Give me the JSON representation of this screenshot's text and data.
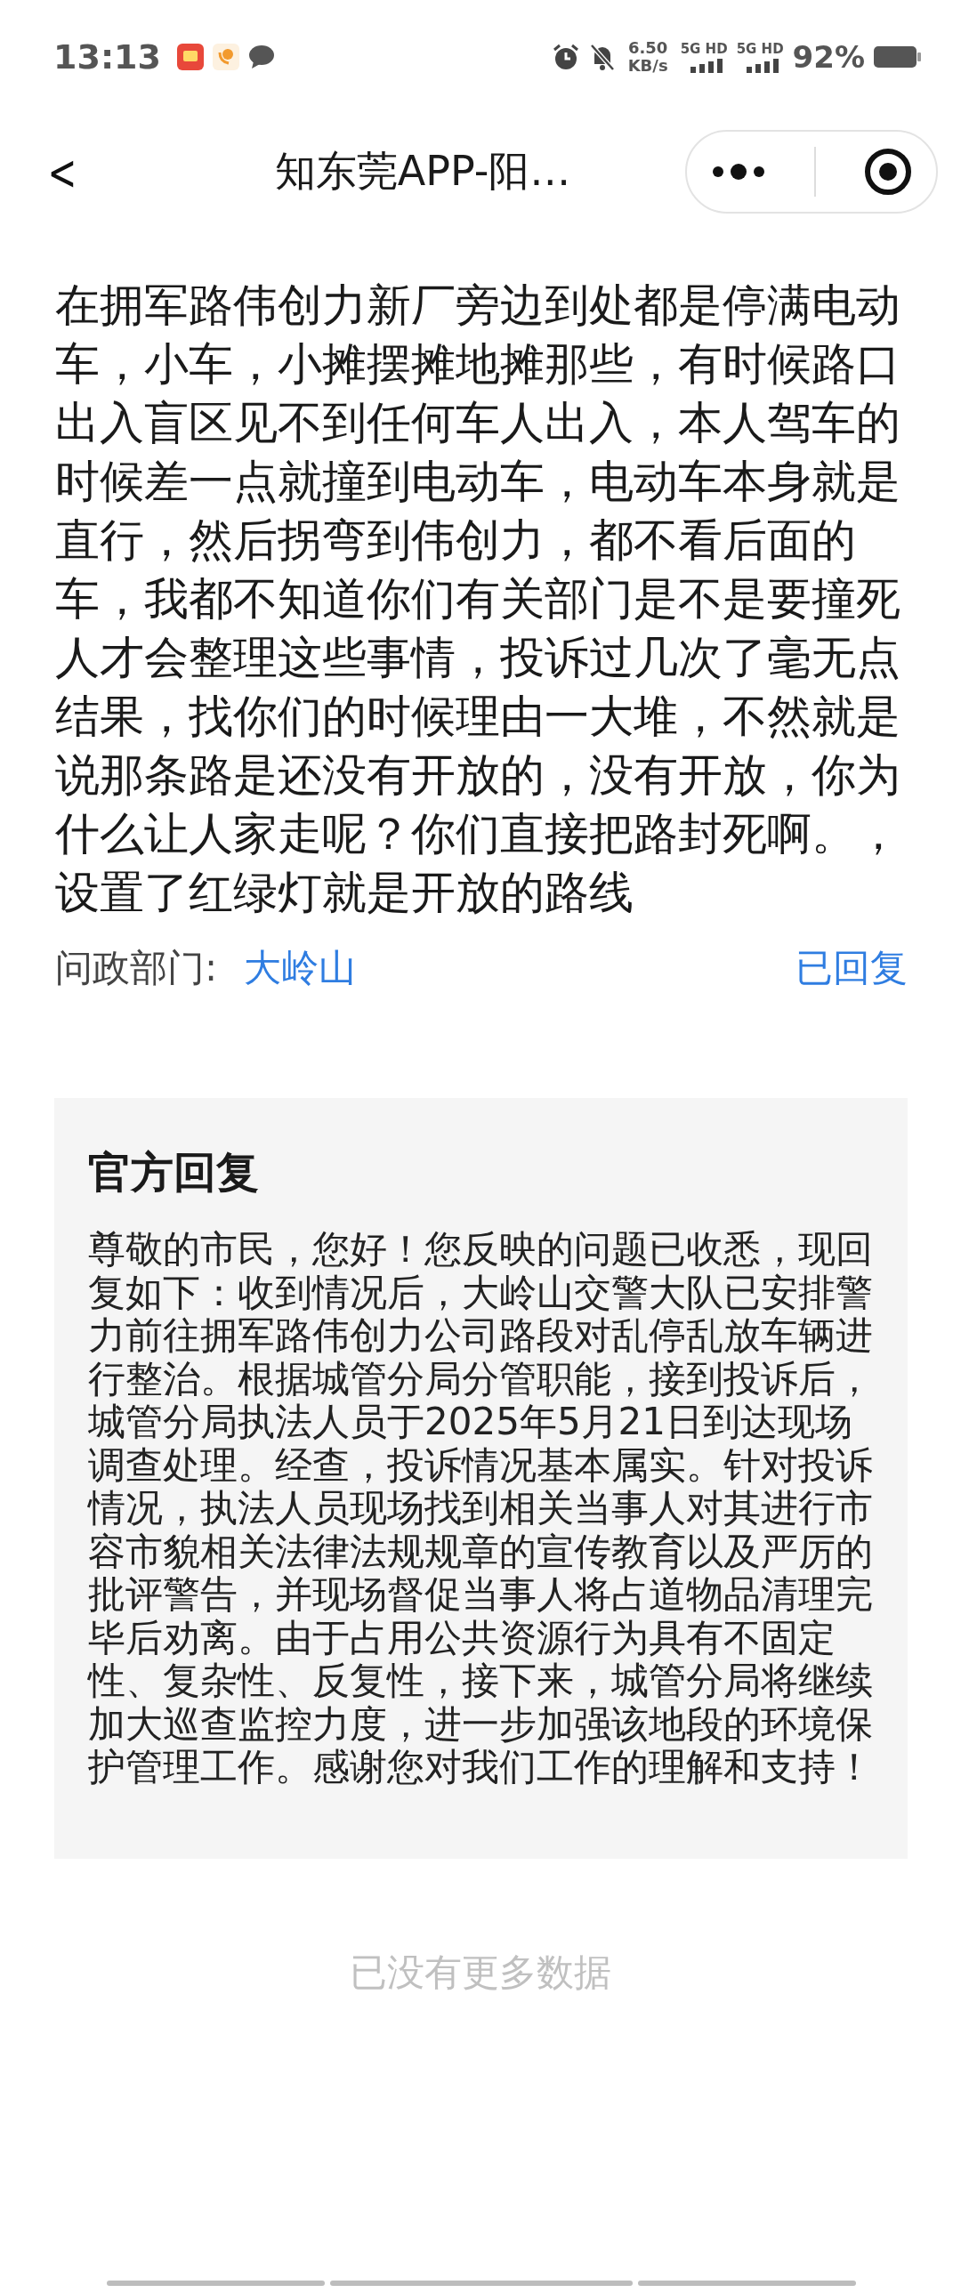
{
  "status_bar": {
    "time": "13:13",
    "speed_value": "6.50",
    "speed_unit": "KB/s",
    "network_labels": [
      "5G HD",
      "5G HD"
    ],
    "battery": "92%"
  },
  "nav_bar": {
    "back": "<",
    "title": "知东莞APP-阳…"
  },
  "complaint": {
    "text": "在拥军路伟创力新厂旁边到处都是停满电动车，小车，小摊摆摊地摊那些，有时候路口出入盲区见不到任何车人出入，本人驾车的时候差一点就撞到电动车，电动车本身就是直行，然后拐弯到伟创力，都不看后面的车，我都不知道你们有关部门是不是要撞死人才会整理这些事情，投诉过几次了毫无点结果，找你们的时候理由一大堆，不然就是说那条路是还没有开放的，没有开放，你为什么让人家走呢？你们直接把路封死啊。，设置了红绿灯就是开放的路线",
    "department_label": "问政部门:",
    "department": "大岭山",
    "status": "已回复"
  },
  "reply": {
    "title": "官方回复",
    "text": "尊敬的市民，您好！您反映的问题已收悉，现回复如下：收到情况后，大岭山交警大队已安排警力前往拥军路伟创力公司路段对乱停乱放车辆进行整治。根据城管分局分管职能，接到投诉后，城管分局执法人员于2025年5月21日到达现场调查处理。经查，投诉情况基本属实。针对投诉情况，执法人员现场找到相关当事人对其进行市容市貌相关法律法规规章的宣传教育以及严厉的批评警告，并现场督促当事人将占道物品清理完毕后劝离。由于占用公共资源行为具有不固定性、复杂性、反复性，接下来，城管分局将继续加大巡查监控力度，进一步加强该地段的环境保护管理工作。感谢您对我们工作的理解和支持！"
  },
  "footer": "已没有更多数据"
}
